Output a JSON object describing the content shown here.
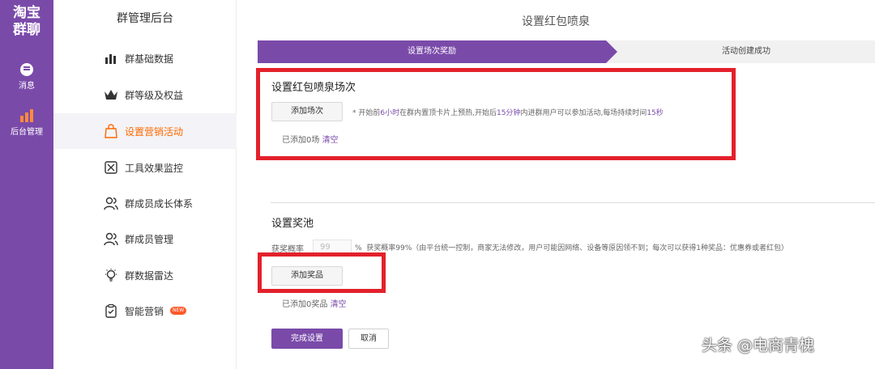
{
  "rail": {
    "brand": "淘宝\n群聊",
    "items": [
      {
        "label": "消息",
        "icon": "chat-bubble-icon"
      },
      {
        "label": "后台管理",
        "icon": "bar-chart-icon"
      }
    ]
  },
  "sidebar": {
    "title": "群管理后台",
    "items": [
      {
        "label": "群基础数据",
        "icon": "bar-chart-icon"
      },
      {
        "label": "群等级及权益",
        "icon": "crown-icon"
      },
      {
        "label": "设置营销活动",
        "icon": "shopping-bag-icon",
        "active": true
      },
      {
        "label": "工具效果监控",
        "icon": "monitor-icon"
      },
      {
        "label": "群成员成长体系",
        "icon": "users-icon"
      },
      {
        "label": "群成员管理",
        "icon": "user-manage-icon"
      },
      {
        "label": "群数据雷达",
        "icon": "lightbulb-icon"
      },
      {
        "label": "智能营销",
        "icon": "clipboard-icon",
        "badge": "NEW"
      }
    ]
  },
  "page": {
    "title": "设置红包喷泉",
    "steps": [
      "设置场次奖励",
      "活动创建成功"
    ]
  },
  "session": {
    "title": "设置红包喷泉场次",
    "add_button": "添加场次",
    "hint_parts": [
      "* 开始前",
      "6小时",
      "在群内置顶卡片上预热,开始后",
      "15分钟",
      "内进群用户可以参加活动,每场持续时间",
      "15秒"
    ],
    "added_text": "已添加0场",
    "clear_link": "清空"
  },
  "prize": {
    "title": "设置奖池",
    "rate_label": "获奖概率",
    "rate_value": "99",
    "rate_unit": "%",
    "rate_note": "获奖概率99%（由平台统一控制，商家无法修改，用户可能因网络、设备等原因领不到；每次可以获得1种奖品：优惠券或者红包）",
    "add_button": "添加奖品",
    "added_text": "已添加0奖品",
    "clear_link": "清空"
  },
  "actions": {
    "confirm": "完成设置",
    "cancel": "取消"
  },
  "watermark": "头条 @电商青槐",
  "colors": {
    "accent": "#7a4aa9",
    "active_menu": "#ff6a00",
    "highlight_border": "#e3212b"
  }
}
